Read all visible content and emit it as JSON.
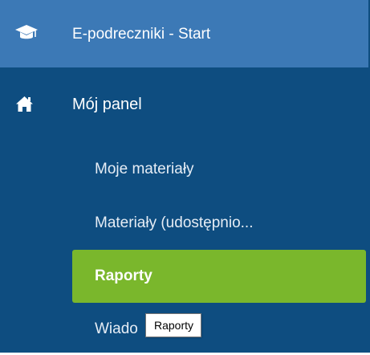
{
  "app": {
    "title": "E-podreczniki - Start",
    "logo_icon": "graduation-cap-icon"
  },
  "nav": {
    "home": {
      "icon": "home-icon",
      "label": "Mój panel"
    },
    "items": [
      {
        "label": "Moje materiały",
        "active": false
      },
      {
        "label": "Materiały (udostępnio...",
        "active": false
      },
      {
        "label": "Raporty",
        "active": true
      },
      {
        "label": "Wiado",
        "active": false
      }
    ]
  },
  "tooltip": {
    "text": "Raporty"
  },
  "colors": {
    "header_bg": "#3c79b6",
    "sidebar_bg": "#0e4d80",
    "active_bg": "#7ab72c"
  }
}
